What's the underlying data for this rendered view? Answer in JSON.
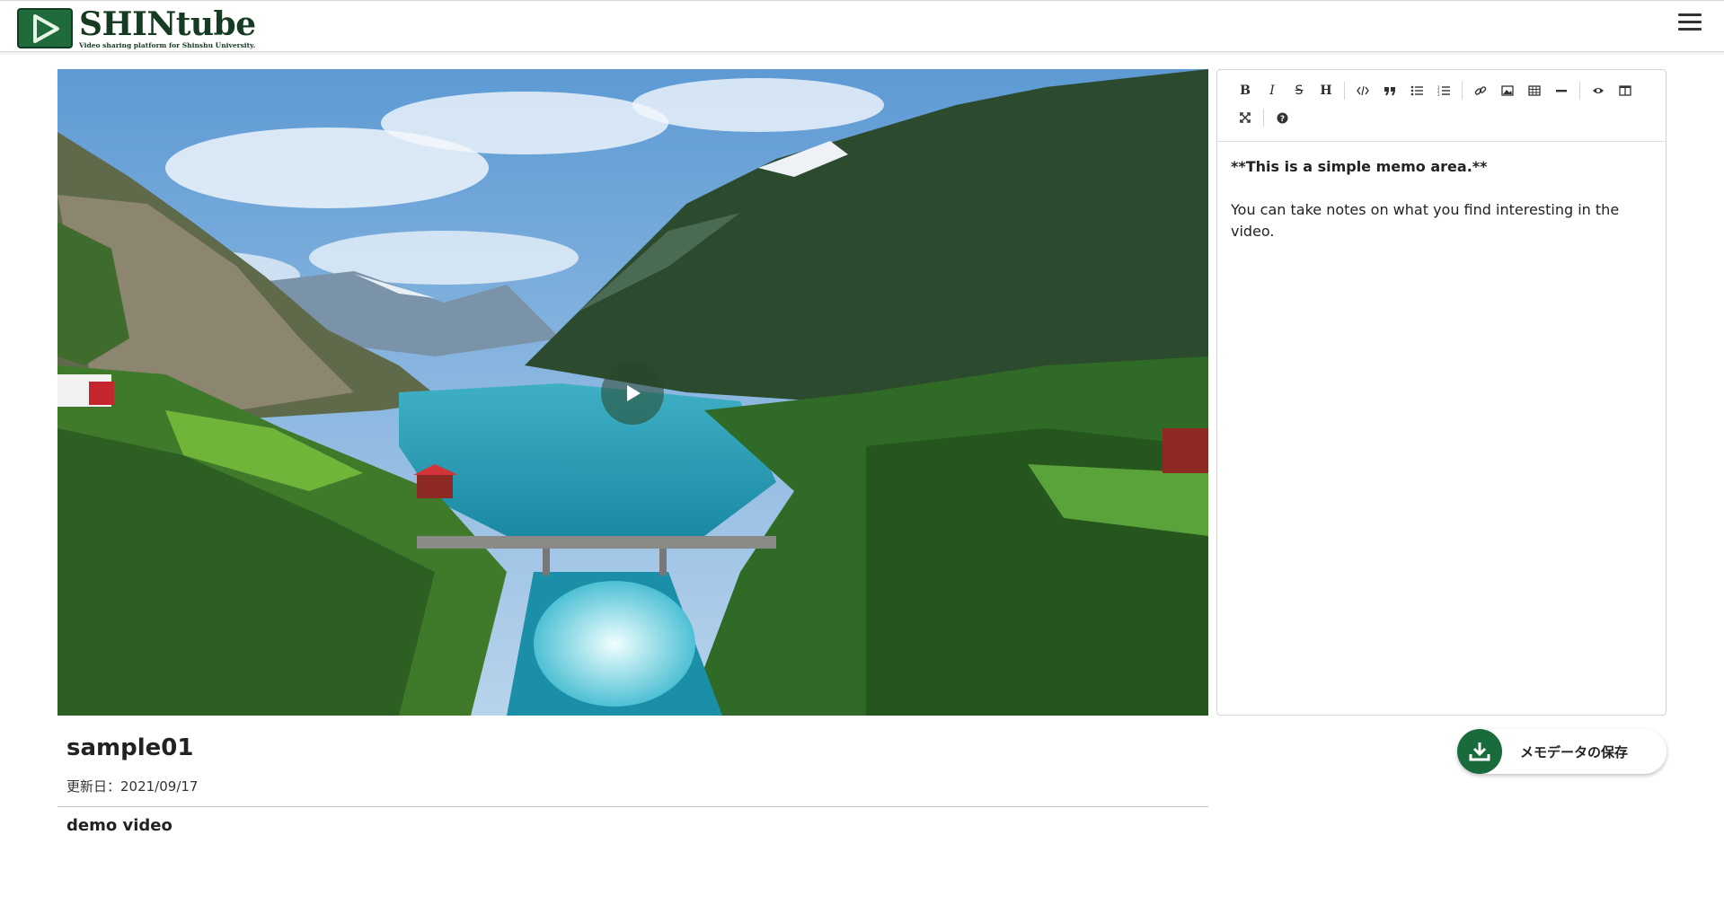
{
  "header": {
    "logo_title": "SHINtube",
    "logo_subtitle": "Video sharing platform for Shinshu University.",
    "menu_icon": "hamburger-menu-icon"
  },
  "video": {
    "play_icon": "play-icon"
  },
  "editor": {
    "toolbar": [
      {
        "name": "bold",
        "icon": "bold-icon"
      },
      {
        "name": "italic",
        "icon": "italic-icon"
      },
      {
        "name": "strikethrough",
        "icon": "strikethrough-icon"
      },
      {
        "name": "heading",
        "icon": "heading-icon"
      },
      {
        "name": "code",
        "icon": "code-icon"
      },
      {
        "name": "quote",
        "icon": "quote-icon"
      },
      {
        "name": "unordered-list",
        "icon": "unordered-list-icon"
      },
      {
        "name": "ordered-list",
        "icon": "ordered-list-icon"
      },
      {
        "name": "link",
        "icon": "link-icon"
      },
      {
        "name": "image",
        "icon": "image-icon"
      },
      {
        "name": "table",
        "icon": "table-icon"
      },
      {
        "name": "horizontal-rule",
        "icon": "horizontal-rule-icon"
      },
      {
        "name": "preview",
        "icon": "eye-icon"
      },
      {
        "name": "side-by-side",
        "icon": "columns-icon"
      },
      {
        "name": "fullscreen",
        "icon": "fullscreen-icon"
      },
      {
        "name": "guide",
        "icon": "question-icon"
      }
    ],
    "memo_line1": "**This is a simple memo area.**",
    "memo_line2": "You can take notes on what you find interesting in the video."
  },
  "info": {
    "title": "sample01",
    "updated": "更新日：2021/09/17",
    "description": "demo video"
  },
  "save_button": {
    "label": "メモデータの保存",
    "icon": "download-icon"
  },
  "colors": {
    "brand_green": "#1a6b3c",
    "logo_text": "#173b22"
  }
}
